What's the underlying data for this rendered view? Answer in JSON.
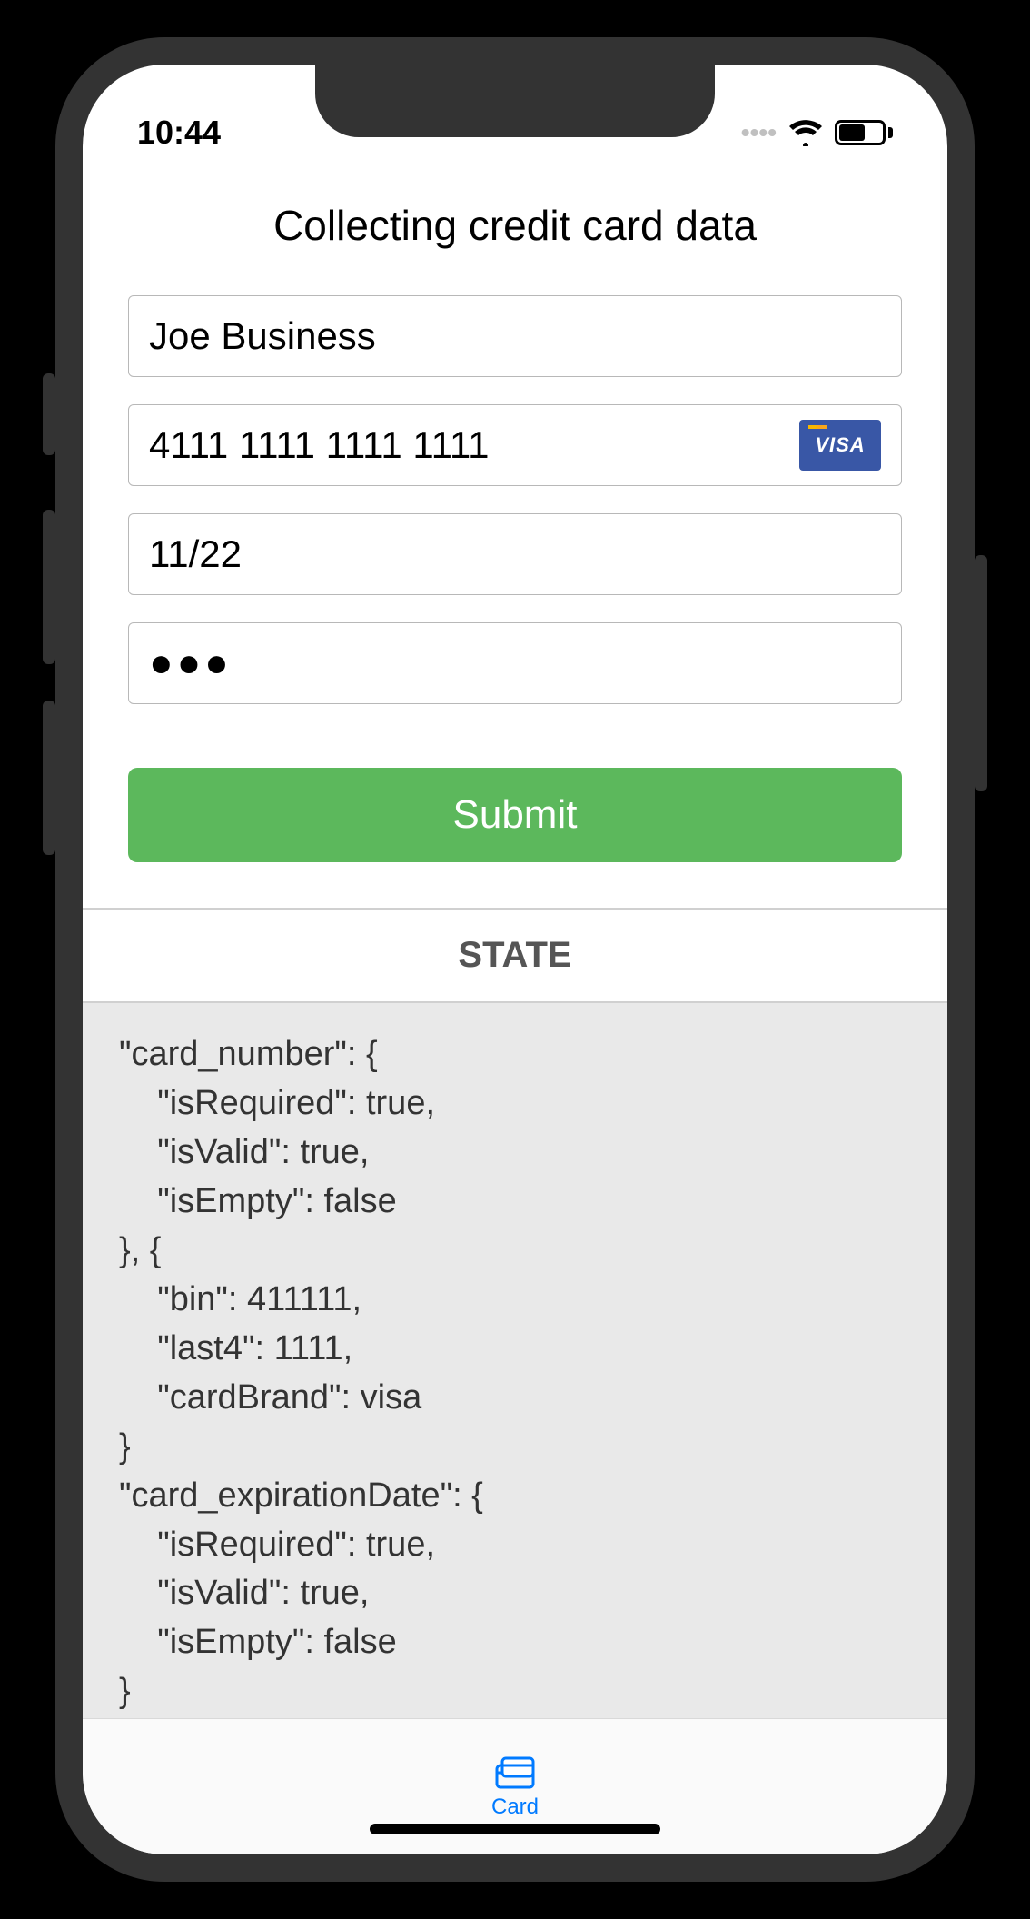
{
  "statusBar": {
    "time": "10:44"
  },
  "header": {
    "title": "Collecting credit card data"
  },
  "form": {
    "name": {
      "value": "Joe Business"
    },
    "cardNumber": {
      "value": "4111 1111 1111 1111",
      "brand": "VISA"
    },
    "expiry": {
      "value": "11/22"
    },
    "cvc": {
      "masked": "●●●"
    },
    "submit": {
      "label": "Submit"
    }
  },
  "statePanel": {
    "heading": "STATE",
    "body": "\"card_number\": {\n    \"isRequired\": true,\n    \"isValid\": true,\n    \"isEmpty\": false\n}, {\n    \"bin\": 411111,\n    \"last4\": 1111,\n    \"cardBrand\": visa\n}\n\"card_expirationDate\": {\n    \"isRequired\": true,\n    \"isValid\": true,\n    \"isEmpty\": false\n}\n\"card_cvc\": {"
  },
  "tabBar": {
    "card": {
      "label": "Card"
    }
  },
  "colors": {
    "submitButton": "#5cb85c",
    "accent": "#007aff",
    "visaBadge": "#3957a6"
  }
}
